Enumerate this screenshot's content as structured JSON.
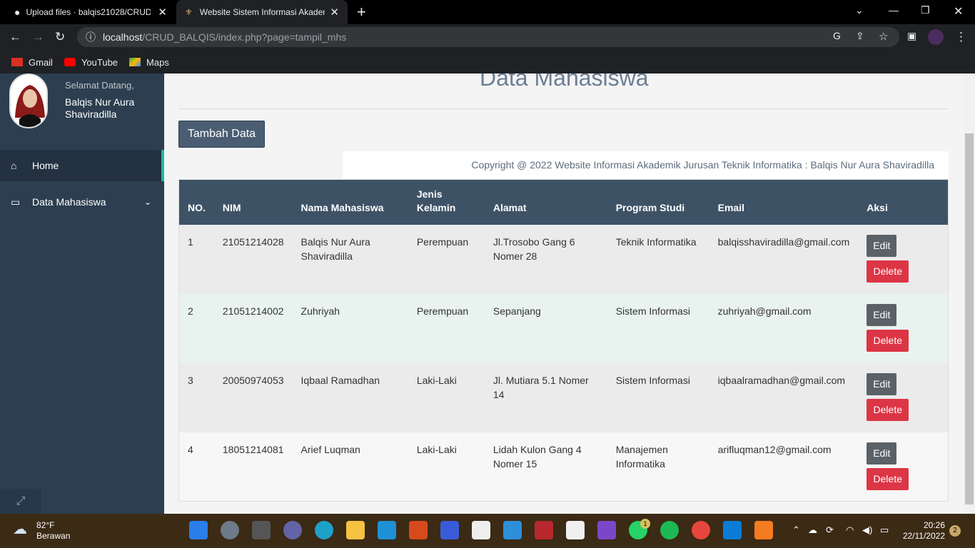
{
  "browser": {
    "tabs": [
      {
        "title": "Upload files · balqis21028/CRUD"
      },
      {
        "title": "Website Sistem Informasi Akadem"
      }
    ],
    "url_host": "localhost",
    "url_path": "/CRUD_BALQIS/index.php?page=tampil_mhs",
    "bookmarks": [
      "Gmail",
      "YouTube",
      "Maps"
    ]
  },
  "sidebar": {
    "welcome": "Selamat Datang,",
    "user_name": "Balqis Nur Aura Shaviradilla",
    "menu": [
      {
        "label": "Home",
        "icon": "home-icon"
      },
      {
        "label": "Data Mahasiswa",
        "icon": "monitor-icon"
      }
    ]
  },
  "main": {
    "title": "Data Mahasiswa",
    "add_button": "Tambah Data",
    "copyright": "Copyright @ 2022 Website Informasi Akademik Jurusan Teknik Informatika : Balqis Nur Aura Shaviradilla",
    "columns": [
      "NO.",
      "NIM",
      "Nama Mahasiswa",
      "Jenis Kelamin",
      "Alamat",
      "Program Studi",
      "Email",
      "Aksi"
    ],
    "rows": [
      {
        "no": "1",
        "nim": "21051214028",
        "nama": "Balqis Nur Aura Shaviradilla",
        "jk": "Perempuan",
        "alamat": "Jl.Trosobo Gang 6 Nomer 28",
        "prodi": "Teknik Informatika",
        "email": "balqisshaviradilla@gmail.com"
      },
      {
        "no": "2",
        "nim": "21051214002",
        "nama": "Zuhriyah",
        "jk": "Perempuan",
        "alamat": "Sepanjang",
        "prodi": "Sistem Informasi",
        "email": "zuhriyah@gmail.com"
      },
      {
        "no": "3",
        "nim": "20050974053",
        "nama": "Iqbaal Ramadhan",
        "jk": "Laki-Laki",
        "alamat": "Jl. Mutiara 5.1 Nomer 14",
        "prodi": "Sistem Informasi",
        "email": "iqbaalramadhan@gmail.com"
      },
      {
        "no": "4",
        "nim": "18051214081",
        "nama": "Arief Luqman",
        "jk": "Laki-Laki",
        "alamat": "Lidah Kulon Gang 4 Nomer 15",
        "prodi": "Manajemen Informatika",
        "email": "arifluqman12@gmail.com"
      }
    ],
    "edit_label": "Edit",
    "delete_label": "Delete"
  },
  "taskbar": {
    "temp": "82°F",
    "weather": "Berawan",
    "time": "20:26",
    "date": "22/11/2022",
    "notifications": "2",
    "whatsapp_badge": "1"
  }
}
